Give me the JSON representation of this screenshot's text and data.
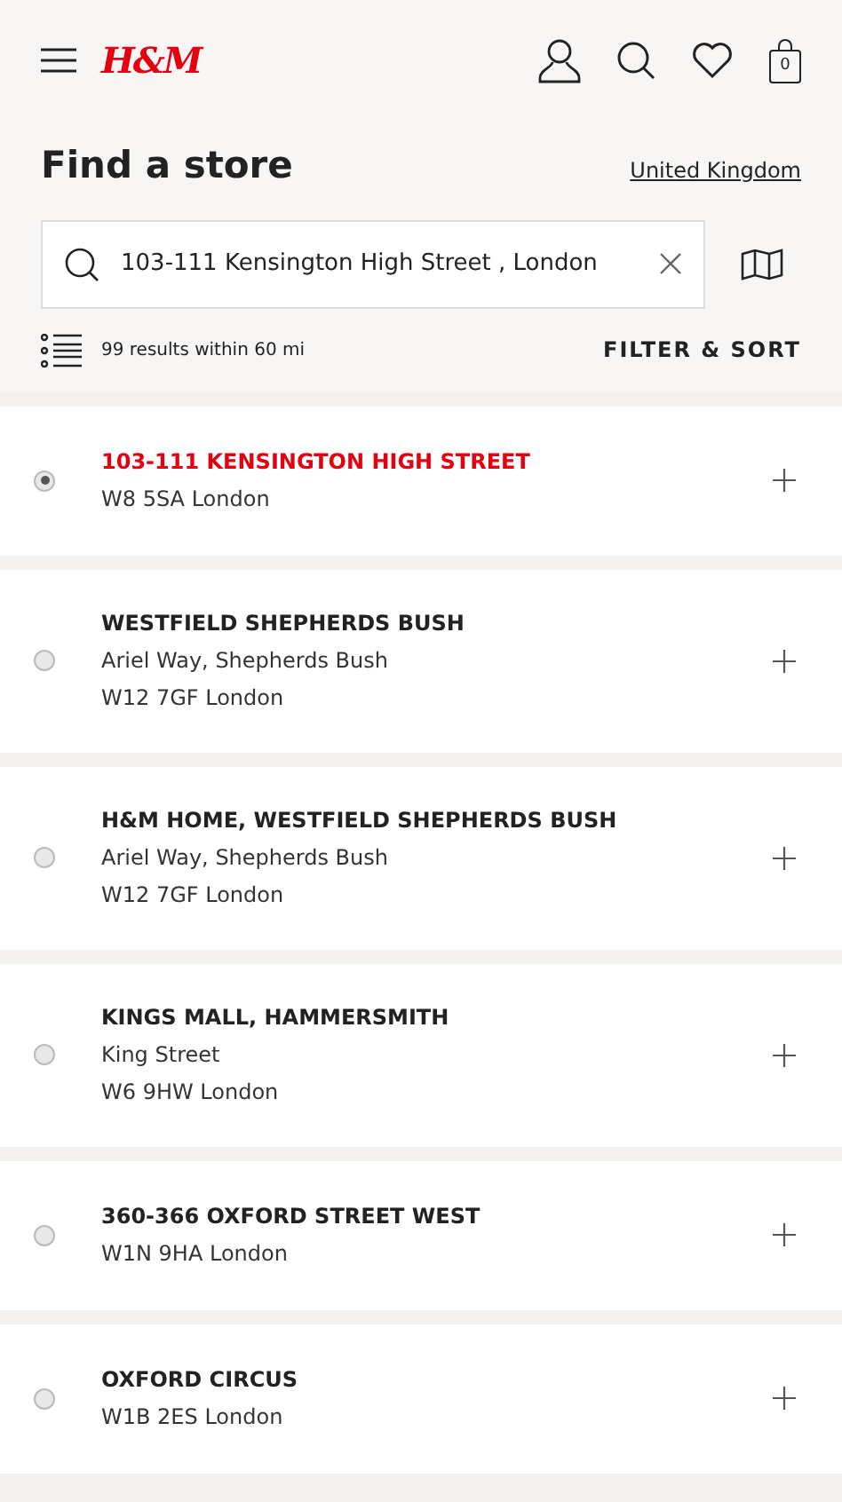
{
  "header": {
    "logo": "H&M",
    "bag_count": "0"
  },
  "title": "Find a store",
  "country_link": "United Kingdom",
  "search": {
    "value": "103-111 Kensington High Street , London"
  },
  "results": {
    "summary": "99 results within 60 mi",
    "filter_button": "FILTER & SORT"
  },
  "stores": [
    {
      "name": "103-111 KENSINGTON HIGH STREET",
      "lines": [
        "W8 5SA London"
      ],
      "selected": true
    },
    {
      "name": "WESTFIELD SHEPHERDS BUSH",
      "lines": [
        "Ariel Way, Shepherds Bush",
        "W12 7GF London"
      ],
      "selected": false
    },
    {
      "name": "H&M HOME, WESTFIELD SHEPHERDS BUSH",
      "lines": [
        "Ariel Way, Shepherds Bush",
        "W12 7GF London"
      ],
      "selected": false
    },
    {
      "name": "KINGS MALL, HAMMERSMITH",
      "lines": [
        "King Street",
        "W6 9HW London"
      ],
      "selected": false
    },
    {
      "name": "360-366 OXFORD STREET WEST",
      "lines": [
        "W1N 9HA London"
      ],
      "selected": false
    },
    {
      "name": "OXFORD CIRCUS",
      "lines": [
        "W1B 2ES London"
      ],
      "selected": false
    }
  ]
}
